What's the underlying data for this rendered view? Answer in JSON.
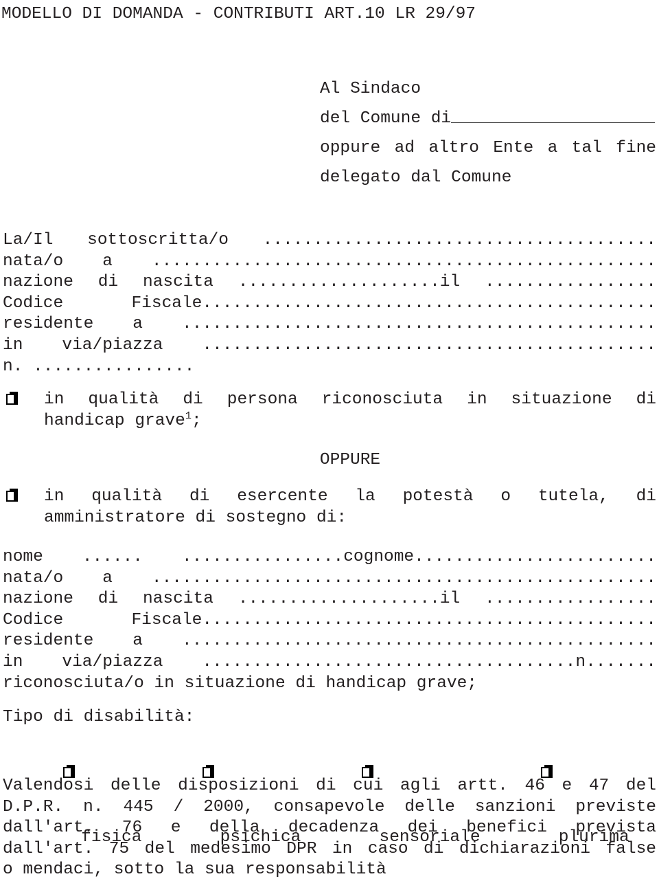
{
  "document": {
    "title": "MODELLO DI DOMANDA - CONTRIBUTI ART.10 LR 29/97"
  },
  "addressee": {
    "line1": "Al Sindaco",
    "line2_prefix": "del Comune di",
    "line3": "oppure ad altro Ente a tal fine",
    "line4": "delegato dal Comune"
  },
  "applicant_fields": {
    "line1": "La/Il sottoscritta/o .......................................",
    "line2": "nata/o a ..................................................",
    "line3": "nazione di nascita ....................il .................",
    "line4": "Codice Fiscale.............................................",
    "line5": "residente a ...............................................",
    "line6": "in via/piazza .............................................",
    "line7": "n. ................"
  },
  "option_one": {
    "line1": "in qualità di persona riconosciuta in situazione di",
    "line2_prefix": "handicap grave",
    "footnote_marker": "1",
    "line2_suffix": ";"
  },
  "separator": {
    "label": "OPPURE"
  },
  "option_two": {
    "line1": "in qualità di esercente la potestà o tutela, di",
    "line2": "amministratore di sostegno di:"
  },
  "beneficiary_fields": {
    "line1": "nome ...... ................cognome........................",
    "line2": "nata/o a ..................................................",
    "line3": "nazione di nascita ....................il .................",
    "line4": "Codice Fiscale.............................................",
    "line5": "residente a ...............................................",
    "line6": "in via/piazza .....................................n.......",
    "line7": "riconosciuta/o in situazione di handicap grave;"
  },
  "disability": {
    "heading": "Tipo di disabilità:",
    "options": [
      {
        "label": "fisica"
      },
      {
        "label": "psichica"
      },
      {
        "label": "sensoriale"
      },
      {
        "label": "plurima"
      }
    ]
  },
  "declaration": {
    "line1": "Valendosi delle disposizioni di cui agli artt. 46 e 47 del",
    "line2": "D.P.R. n. 445 / 2000, consapevole delle sanzioni previste",
    "line3": "dall'art. 76 e della decadenza dei benefici prevista",
    "line4": "dall'art. 75 del medesimo DPR in caso di dichiarazioni false",
    "line5": "o mendaci, sotto la sua responsabilità"
  },
  "colors": {
    "text": "#231f20",
    "rule": "#3c3c3c",
    "background": "#ffffff"
  }
}
